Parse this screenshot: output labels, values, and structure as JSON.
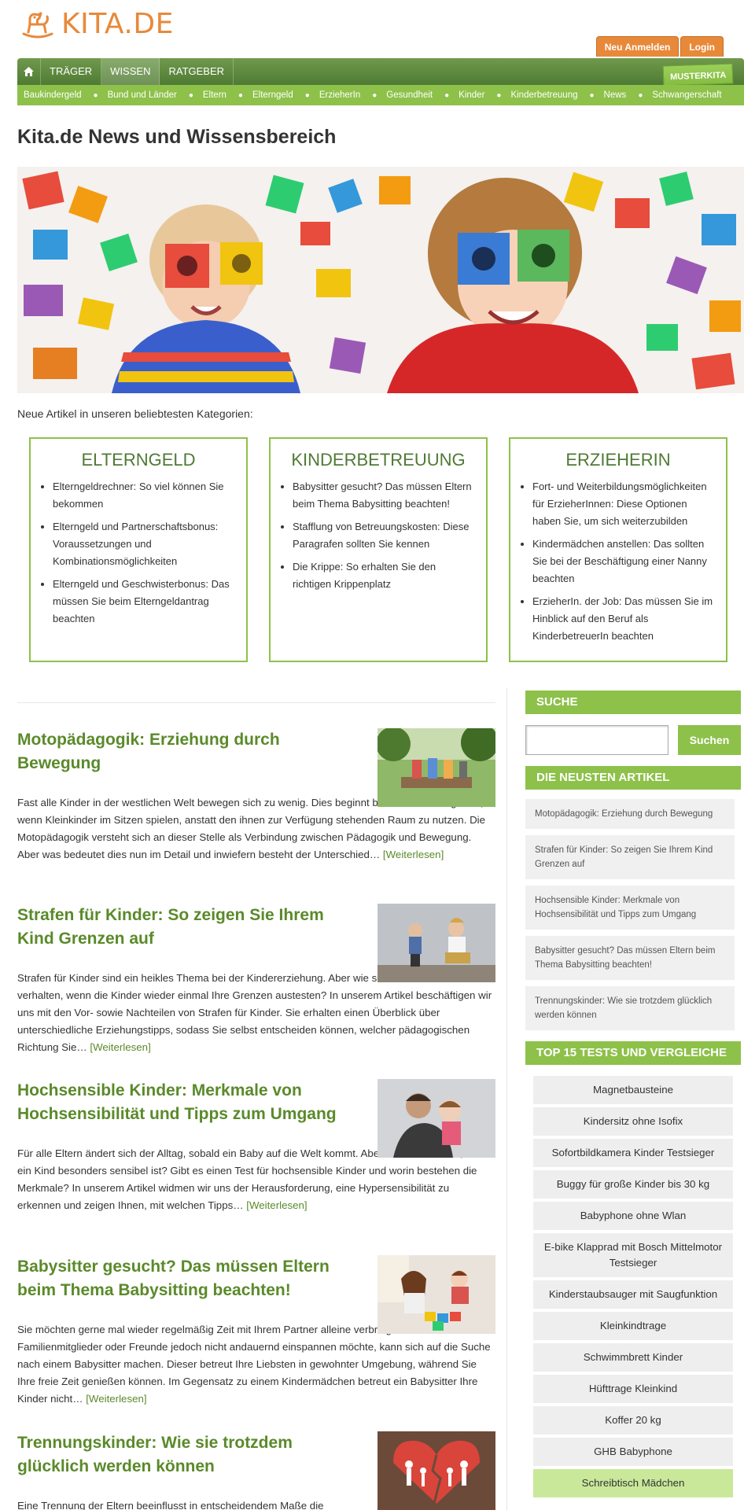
{
  "header": {
    "logo_text": "KITA.DE",
    "register_label": "Neu Anmelden",
    "login_label": "Login"
  },
  "mainnav": {
    "items": [
      {
        "label": "TRÄGER"
      },
      {
        "label": "WISSEN"
      },
      {
        "label": "RATGEBER"
      }
    ],
    "musterkita_label": "MUSTERKITA"
  },
  "subnav": {
    "items": [
      {
        "label": "Baukindergeld"
      },
      {
        "label": "Bund und Länder"
      },
      {
        "label": "Eltern"
      },
      {
        "label": "Elterngeld"
      },
      {
        "label": "ErzieherIn"
      },
      {
        "label": "Gesundheit"
      },
      {
        "label": "Kinder"
      },
      {
        "label": "Kinderbetreuung"
      },
      {
        "label": "News"
      },
      {
        "label": "Schwangerschaft"
      }
    ]
  },
  "page": {
    "title": "Kita.de News und Wissensbereich",
    "intro": "Neue Artikel in unseren beliebtesten Kategorien:"
  },
  "categories": [
    {
      "title": "ELTERNGELD",
      "items": [
        "Elterngeldrechner: So viel können Sie bekommen",
        "Elterngeld und Partnerschaftsbonus: Voraussetzungen und Kombinationsmöglichkeiten",
        "Elterngeld und Geschwisterbonus: Das müssen Sie beim Elterngeldantrag beachten"
      ]
    },
    {
      "title": "KINDERBETREUUNG",
      "items": [
        "Babysitter gesucht? Das müssen Eltern beim Thema Babysitting beachten!",
        "Stafflung von Betreuungskosten: Diese Paragrafen sollten Sie kennen",
        "Die Krippe: So erhalten Sie den richtigen Krippenplatz"
      ]
    },
    {
      "title": "ERZIEHERIN",
      "items": [
        "Fort- und Weiterbildungsmöglichkeiten für ErzieherInnen: Diese Optionen haben Sie, um sich weiterzubilden",
        "Kindermädchen anstellen: Das sollten Sie bei der Beschäftigung einer Nanny beachten",
        "ErzieherIn. der Job: Das müssen Sie im Hinblick auf den Beruf als KinderbetreuerIn beachten"
      ]
    }
  ],
  "articles": [
    {
      "title": "Motopädagogik: Erziehung durch Bewegung",
      "text": "Fast alle Kinder in der westlichen Welt bewegen sich zu wenig. Dies beginnt bereits im Kindergarten, wenn Kleinkinder im Sitzen spielen, anstatt den ihnen zur Verfügung stehenden Raum zu nutzen. Die Motopädagogik versteht sich an dieser Stelle als Verbindung zwischen Pädagogik und Bewegung. Aber was bedeutet dies nun im Detail und inwiefern besteht der Unterschied…",
      "more": "[Weiterlesen]"
    },
    {
      "title": "Strafen für Kinder: So zeigen Sie Ihrem Kind Grenzen auf",
      "text": "Strafen für Kinder sind ein heikles Thema bei der Kindererziehung. Aber wie sollten sich Eltern verhalten, wenn die Kinder wieder einmal Ihre Grenzen austesten? In unserem Artikel beschäftigen wir uns mit den Vor- sowie Nachteilen von Strafen für Kinder. Sie erhalten einen Überblick über unterschiedliche Erziehungstipps, sodass Sie selbst entscheiden können, welcher pädagogischen Richtung Sie…",
      "more": "[Weiterlesen]"
    },
    {
      "title": "Hochsensible Kinder: Merkmale von Hochsensibilität und Tipps zum Umgang",
      "text": "Für alle Eltern ändert sich der Alltag, sobald ein Baby auf die Welt kommt. Aber wie sieht es aus, wenn ein Kind besonders sensibel ist? Gibt es einen Test für hochsensible Kinder und worin bestehen die Merkmale? In unserem Artikel widmen wir uns der Herausforderung, eine Hypersensibilität zu erkennen und zeigen Ihnen, mit welchen Tipps…",
      "more": "[Weiterlesen]"
    },
    {
      "title": "Babysitter gesucht? Das müssen Eltern beim Thema Babysitting beachten!",
      "text": "Sie möchten gerne mal wieder regelmäßig Zeit mit Ihrem Partner alleine verbringen? Wer Familienmitglieder oder Freunde jedoch nicht andauernd einspannen möchte, kann sich auf die Suche nach einem Babysitter machen. Dieser betreut Ihre Liebsten in gewohnter Umgebung, während Sie Ihre freie Zeit genießen können. Im Gegensatz zu einem Kindermädchen betreut ein Babysitter Ihre Kinder nicht…",
      "more": "[Weiterlesen]"
    },
    {
      "title": "Trennungskinder: Wie sie trotzdem glücklich werden können",
      "text": "Eine Trennung der Eltern beeinflusst in entscheidendem Maße die",
      "more": ""
    }
  ],
  "sidebar": {
    "search_title": "SUCHE",
    "search_value": "",
    "search_button": "Suchen",
    "newest_title": "DIE NEUSTEN ARTIKEL",
    "newest": [
      "Motopädagogik: Erziehung durch Bewegung",
      "Strafen für Kinder: So zeigen Sie Ihrem Kind Grenzen auf",
      "Hochsensible Kinder: Merkmale von Hochsensibilität und Tipps zum Umgang",
      "Babysitter gesucht? Das müssen Eltern beim Thema Babysitting beachten!",
      "Trennungskinder: Wie sie trotzdem glücklich werden können"
    ],
    "tests_title": "TOP 15 TESTS UND VERGLEICHE",
    "tests": [
      "Magnetbausteine",
      "Kindersitz ohne Isofix",
      "Sofortbildkamera Kinder Testsieger",
      "Buggy für große Kinder bis 30 kg",
      "Babyphone ohne Wlan",
      "E-bike Klapprad mit Bosch Mittelmotor Testsieger",
      "Kinderstaubsauger mit Saugfunktion",
      "Kleinkindtrage",
      "Schwimmbrett Kinder",
      "Hüfttrage Kleinkind",
      "Koffer 20 kg",
      "GHB Babyphone",
      "Schreibtisch Mädchen"
    ]
  },
  "colors": {
    "brand_orange": "#e8893a",
    "nav_green": "#5a8a3a",
    "accent_green": "#8dc14a",
    "title_green": "#5a8a2a"
  }
}
